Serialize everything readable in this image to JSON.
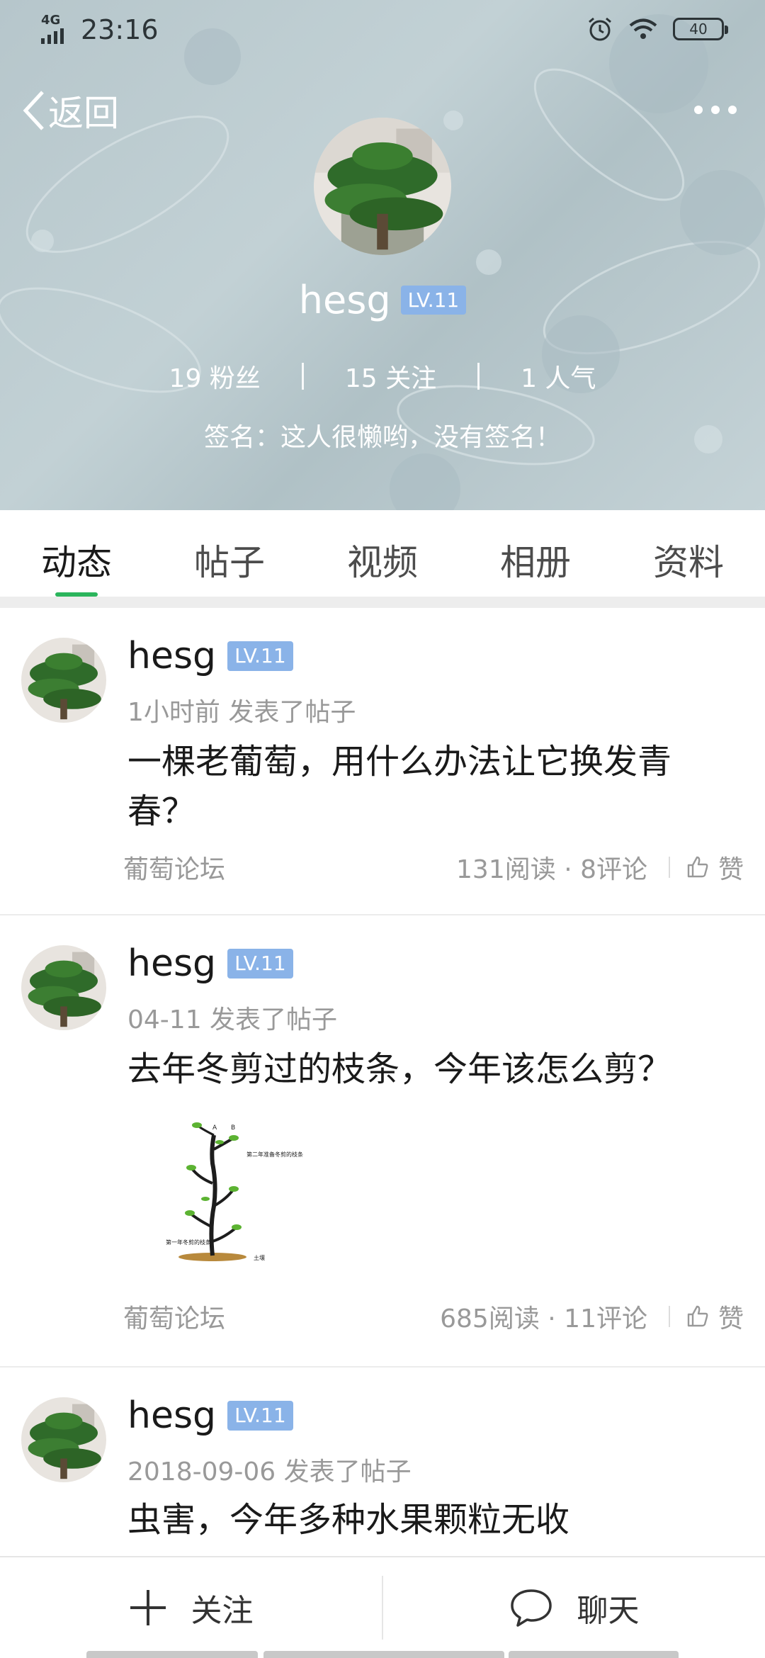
{
  "status_bar": {
    "network": "4G",
    "time": "23:16",
    "battery": "40"
  },
  "nav": {
    "back_label": "返回"
  },
  "profile": {
    "name": "hesg",
    "level": "LV.11",
    "followers": "19 粉丝",
    "following": "15 关注",
    "popularity": "1 人气",
    "signature": "签名：这人很懒哟，没有签名！"
  },
  "tabs": [
    {
      "label": "动态",
      "active": true
    },
    {
      "label": "帖子",
      "active": false
    },
    {
      "label": "视频",
      "active": false
    },
    {
      "label": "相册",
      "active": false
    },
    {
      "label": "资料",
      "active": false
    }
  ],
  "posts": [
    {
      "author": "hesg",
      "level": "LV.11",
      "meta": "1小时前  发表了帖子",
      "title": "一棵老葡萄，用什么办法让它换发青春？",
      "forum": "葡萄论坛",
      "counts": "131阅读 · 8评论",
      "like_label": "赞"
    },
    {
      "author": "hesg",
      "level": "LV.11",
      "meta": "04-11  发表了帖子",
      "title": "去年冬剪过的枝条，今年该怎么剪？",
      "forum": "葡萄论坛",
      "counts": "685阅读 · 11评论",
      "like_label": "赞",
      "image_labels": {
        "a": "A",
        "b": "B",
        "top_note": "第二年准备冬剪的枝条",
        "left_note": "第一年冬剪的枝条",
        "ground": "土壤"
      }
    },
    {
      "author": "hesg",
      "level": "LV.11",
      "meta": "2018-09-06  发表了帖子",
      "title": "虫害，今年多种水果颗粒无收"
    }
  ],
  "bottom_bar": {
    "follow_label": "关注",
    "chat_label": "聊天"
  },
  "colors": {
    "header_bg": "#b9c9cd",
    "level_badge": "#8ab3e8",
    "tab_indicator": "#2bb55c"
  }
}
